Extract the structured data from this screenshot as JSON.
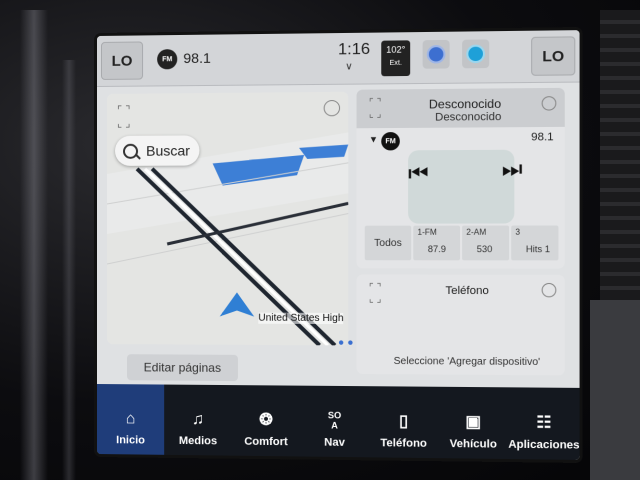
{
  "status_bar": {
    "left_label": "LO",
    "right_label": "LO",
    "radio_badge": "FM",
    "radio_freq": "98.1",
    "time": "1:16",
    "temp": "102°",
    "temp_note": "Ext."
  },
  "nav_card": {
    "search_label": "Buscar",
    "road_label": "United States High"
  },
  "media_card": {
    "title": "Desconocido",
    "subtitle": "Desconocido",
    "badge": "FM",
    "freq": "98.1",
    "presets": [
      {
        "label": "Todos",
        "band": "",
        "value": ""
      },
      {
        "label": "1-FM",
        "band": "",
        "value": "87.9"
      },
      {
        "label": "2-AM",
        "band": "",
        "value": "530"
      },
      {
        "label": "3",
        "band": "",
        "value": "Hits 1"
      }
    ]
  },
  "phone_card": {
    "title": "Teléfono",
    "hint": "Seleccione 'Agregar dispositivo'"
  },
  "edit_pages": "Editar páginas",
  "tabs": [
    {
      "label": "Inicio",
      "icon": "home-icon"
    },
    {
      "label": "Medios",
      "icon": "music-icon"
    },
    {
      "label": "Comfort",
      "icon": "fan-icon"
    },
    {
      "label": "Nav",
      "icon": "compass-icon",
      "top": "SO",
      "top2": "A"
    },
    {
      "label": "Teléfono",
      "icon": "phone-icon"
    },
    {
      "label": "Vehículo",
      "icon": "car-icon"
    },
    {
      "label": "Aplicaciones",
      "icon": "apps-icon"
    }
  ],
  "colors": {
    "active_tab": "#1f3d7a",
    "bottom_bar": "#14181f",
    "map_water": "#3d7fd6",
    "nav_arrow": "#2f7fd4"
  }
}
